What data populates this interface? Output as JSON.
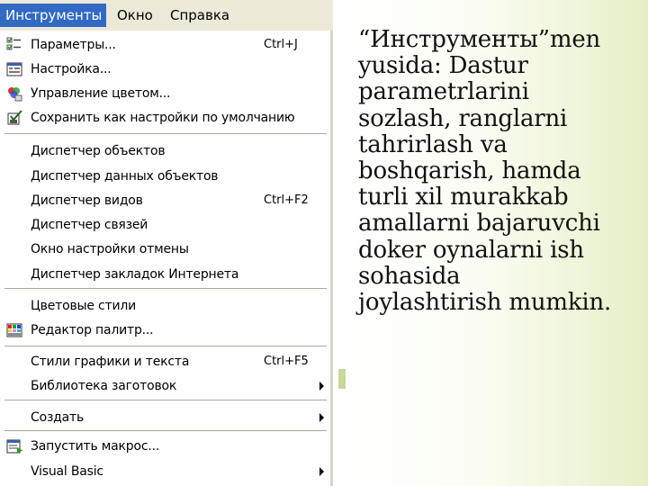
{
  "menubar": {
    "items": [
      {
        "label": "Инструменты",
        "active": true
      },
      {
        "label": "Окно",
        "active": false
      },
      {
        "label": "Справка",
        "active": false
      }
    ]
  },
  "menu": {
    "items": [
      {
        "label": "Параметры...",
        "shortcut": "Ctrl+J",
        "icon": "options-checklist-icon"
      },
      {
        "label": "Настройка...",
        "shortcut": "",
        "icon": "customize-window-icon"
      },
      {
        "label": "Управление цветом...",
        "shortcut": "",
        "icon": "color-management-icon"
      },
      {
        "label": "Сохранить как настройки по умолчанию",
        "shortcut": "",
        "icon": "save-defaults-checkbox-icon"
      },
      {
        "label": "Диспетчер объектов",
        "shortcut": ""
      },
      {
        "label": "Диспетчер данных объектов",
        "shortcut": ""
      },
      {
        "label": "Диспетчер видов",
        "shortcut": "Ctrl+F2"
      },
      {
        "label": "Диспетчер связей",
        "shortcut": ""
      },
      {
        "label": "Окно настройки отмены",
        "shortcut": ""
      },
      {
        "label": "Диспетчер закладок Интернета",
        "shortcut": ""
      },
      {
        "label": "Цветовые стили",
        "shortcut": ""
      },
      {
        "label": "Редактор палитр...",
        "shortcut": "",
        "icon": "palette-editor-icon"
      },
      {
        "label": "Стили графики и текста",
        "shortcut": "Ctrl+F5"
      },
      {
        "label": "Библиотека заготовок",
        "shortcut": "",
        "submenu": true
      },
      {
        "label": "Создать",
        "shortcut": "",
        "submenu": true
      },
      {
        "label": "Запустить макрос...",
        "shortcut": "",
        "icon": "run-macro-icon"
      },
      {
        "label": "Visual Basic",
        "shortcut": "",
        "submenu": true
      }
    ]
  },
  "description": {
    "lines": [
      "“Инструменты”men",
      "yusida: Dastur",
      "parametrlarini",
      "sozlash, ranglarni",
      "tahrirlash va",
      "boshqarish, hamda",
      "turli xil murakkab",
      "amallarni bajaruvchi",
      "doker oynalarni ish",
      "sohasida",
      "joylashtirish mumkin."
    ]
  },
  "colors": {
    "menubar_bg": "#ece9d8",
    "menu_highlight": "#316ac5",
    "background_accent": "#e4efc6"
  }
}
